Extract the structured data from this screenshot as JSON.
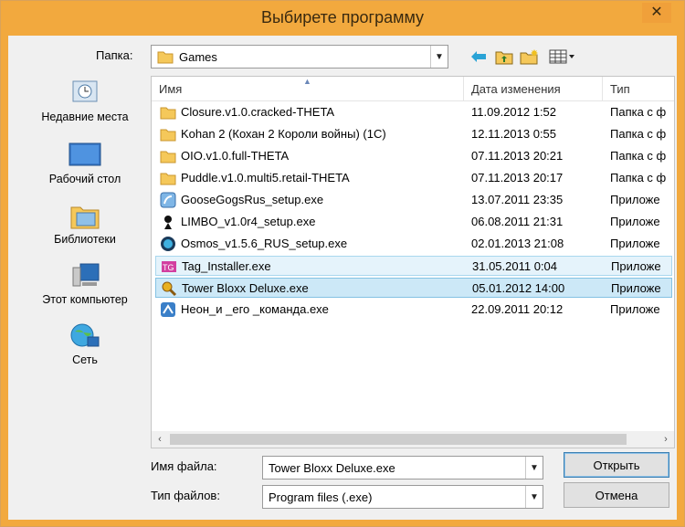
{
  "window": {
    "title": "Выбирете программу",
    "close_glyph": "✕"
  },
  "toolbar": {
    "folder_label": "Папка:",
    "folder_value": "Games"
  },
  "places": [
    {
      "label": "Недавние места",
      "icon": "recent-places-icon"
    },
    {
      "label": "Рабочий стол",
      "icon": "desktop-icon"
    },
    {
      "label": "Библиотеки",
      "icon": "libraries-icon"
    },
    {
      "label": "Этот компьютер",
      "icon": "computer-icon"
    },
    {
      "label": "Сеть",
      "icon": "network-icon"
    }
  ],
  "columns": {
    "name": "Имя",
    "date": "Дата изменения",
    "type": "Тип"
  },
  "files": [
    {
      "name": "Closure.v1.0.cracked-THETA",
      "date": "11.09.2012 1:52",
      "type": "Папка с ф",
      "kind": "folder"
    },
    {
      "name": "Kohan 2 (Кохан 2 Короли войны) (1С)",
      "date": "12.11.2013 0:55",
      "type": "Папка с ф",
      "kind": "folder"
    },
    {
      "name": "OIO.v1.0.full-THETA",
      "date": "07.11.2013 20:21",
      "type": "Папка с ф",
      "kind": "folder"
    },
    {
      "name": "Puddle.v1.0.multi5.retail-THETA",
      "date": "07.11.2013 20:17",
      "type": "Папка с ф",
      "kind": "folder"
    },
    {
      "name": "GooseGogsRus_setup.exe",
      "date": "13.07.2011 23:35",
      "type": "Приложе",
      "kind": "exe"
    },
    {
      "name": "LIMBO_v1.0r4_setup.exe",
      "date": "06.08.2011 21:31",
      "type": "Приложе",
      "kind": "exe"
    },
    {
      "name": "Osmos_v1.5.6_RUS_setup.exe",
      "date": "02.01.2013 21:08",
      "type": "Приложе",
      "kind": "exe"
    },
    {
      "name": "Tag_Installer.exe",
      "date": "31.05.2011 0:04",
      "type": "Приложе",
      "kind": "exe"
    },
    {
      "name": "Tower Bloxx Deluxe.exe",
      "date": "05.01.2012 14:00",
      "type": "Приложе",
      "kind": "exe"
    },
    {
      "name": "Неон_и _его _команда.exe",
      "date": "22.09.2011 20:12",
      "type": "Приложе",
      "kind": "exe"
    }
  ],
  "form": {
    "filename_label": "Имя файла:",
    "filename_value": "Tower Bloxx Deluxe.exe",
    "filetype_label": "Тип файлов:",
    "filetype_value": "Program files (.exe)"
  },
  "buttons": {
    "open": "Открыть",
    "cancel": "Отмена"
  },
  "colors": {
    "frame": "#f2a93e",
    "selection": "#cce8f7",
    "hover": "#e5f3fb"
  }
}
